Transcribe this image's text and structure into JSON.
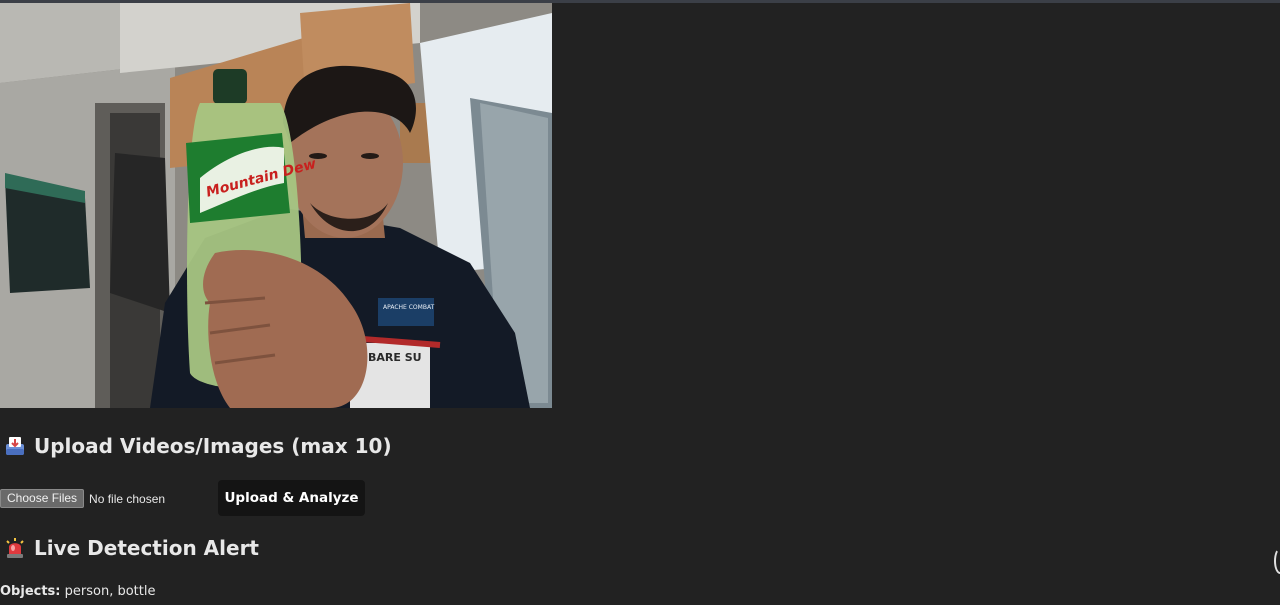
{
  "video_feed": {
    "bottle_label": "Mountain Dew",
    "shirt_text": "APACHE COMBAT",
    "shirt_text_2": "BARE SU"
  },
  "upload_section": {
    "icon": "inbox-tray-icon",
    "title": "Upload Videos/Images (max 10)",
    "choose_files_label": "Choose Files",
    "file_status": "No file chosen",
    "upload_button_label": "Upload & Analyze"
  },
  "alert_section": {
    "icon": "police-light-icon",
    "title": "Live Detection Alert",
    "objects_label": "Objects:",
    "objects_value": "person, bottle"
  },
  "colors": {
    "background": "#222222",
    "button_dark": "#141414",
    "text": "#e8e8e8"
  }
}
